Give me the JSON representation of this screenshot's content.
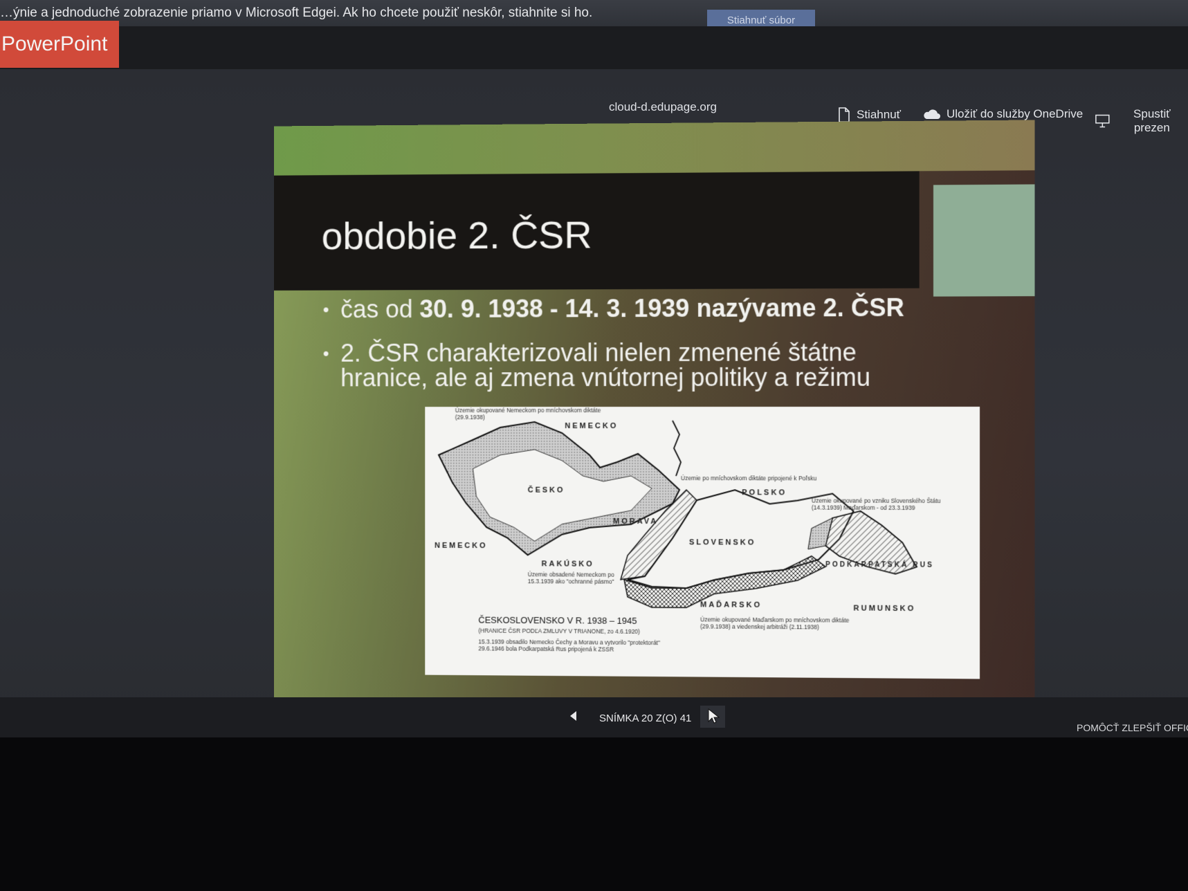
{
  "notice": {
    "text": "…ýnie a jednoduché zobrazenie priamo v Microsoft Edgei. Ak ho chcete použiť neskôr, stiahnite si ho.",
    "button": "Stiahnuť súbor"
  },
  "app": {
    "brand": "PowerPoint",
    "domain": "cloud-d.edupage.org"
  },
  "toolbar": {
    "download": "Stiahnuť",
    "onedrive": "Uložiť do služby OneDrive",
    "present": "Spustiť prezen"
  },
  "slide": {
    "title": "obdobie 2. ČSR",
    "bullet1_prefix": "čas od ",
    "bullet1_bold": "30. 9. 1938 - 14. 3. 1939 nazývame 2. ČSR",
    "bullet2": "2. ČSR charakterizovali nielen zmenené štátne hranice, ale aj zmena vnútornej politiky a režimu"
  },
  "map": {
    "labels": {
      "nemecko_top": "NEMECKO",
      "cesko": "ČESKO",
      "morava": "MORAVA",
      "polsko": "POLSKO",
      "slovensko": "SLOVENSKO",
      "nemecko_left": "NEMECKO",
      "rakusko": "RAKÚSKO",
      "podkarpatska": "PODKARPATSKÁ RUS",
      "madarsko": "MAĎARSKO",
      "rumunsko": "RUMUNSKO"
    },
    "notes": {
      "germany_occupied": "Územie okupované Nemeckom po mníchovskom diktáte (29.9.1938)",
      "poland_annexed": "Územie po mníchovskom diktáte pripojené k Poľsku",
      "hungary_after_slovak_state": "Územie okupované po vzniku Slovenského Štátu (14.3.1939) Maďarskom - od 23.3.1939",
      "protection_zone": "Územie obsadené Nemeckom po 15.3.1939 ako \"ochranné pásmo\"",
      "hungary_occupied": "Územie okupované Maďarskom po mníchovskom diktáte (29.9.1938) a viedenskej arbitráži (2.11.1938)"
    },
    "title": "ČESKOSLOVENSKO V R. 1938 – 1945",
    "subtitle": "(HRANICE ČSR PODĽA ZMLUVY V TRIANONE, zo 4.6.1920)",
    "footnote1": "15.3.1939 obsadilo Nemecko Čechy a Moravu a vytvorilo \"protektorát\"",
    "footnote2": "29.6.1946 bola Podkarpatská Rus pripojená k ZSSR"
  },
  "nav": {
    "counter": "SNÍMKA 20 Z(O) 41",
    "help": "POMÔCŤ ZLEPŠIŤ OFFICE"
  }
}
